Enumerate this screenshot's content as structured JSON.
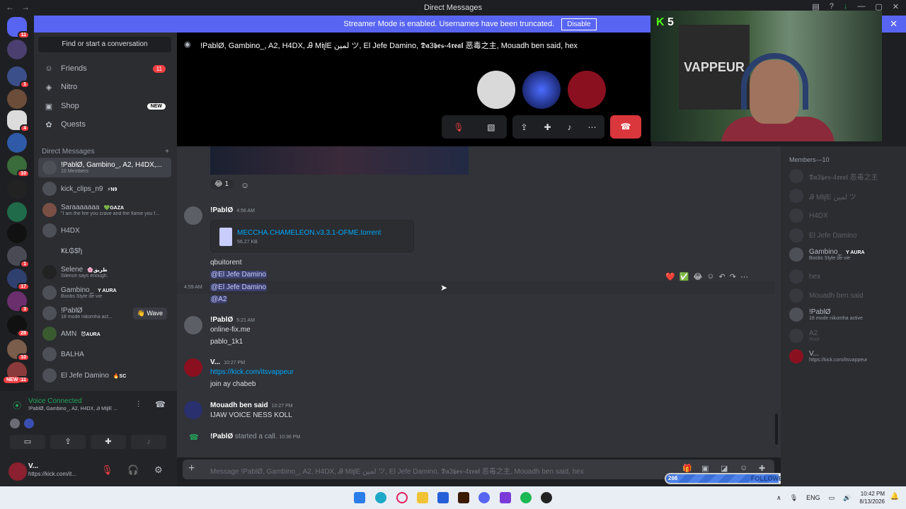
{
  "window": {
    "title": "Direct Messages"
  },
  "banner": {
    "text": "Streamer Mode is enabled. Usernames have been truncated.",
    "button": "Disable"
  },
  "servers": {
    "badges": [
      "11",
      "1",
      "4",
      "10",
      "1",
      "17",
      "3",
      "28",
      "10",
      "111"
    ],
    "new_label": "NEW"
  },
  "dm_sidebar": {
    "search": "Find or start a conversation",
    "nav": [
      {
        "label": "Friends",
        "badge": "11"
      },
      {
        "label": "Nitro"
      },
      {
        "label": "Shop",
        "badge": "NEW"
      },
      {
        "label": "Quests"
      }
    ],
    "header": "Direct Messages",
    "add": "+",
    "dms": [
      {
        "name": "!PablØ, Gambino_, A2, H4DX,...",
        "sub": "10 Members"
      },
      {
        "name": "kick_clips_n9",
        "tag": "⚡N9"
      },
      {
        "name": "Saraaaaaaa",
        "tag": "💚GAZA",
        "sub": "\"I am the fire you crave and the flame you f..."
      },
      {
        "name": "H4DX"
      },
      {
        "name": "ҜŁ₲$ђ"
      },
      {
        "name": "Selene",
        "tag": "🌸طريق",
        "sub": "Silence says enough."
      },
      {
        "name": "Gambino_",
        "tag": "Y AURA",
        "sub": "Boobs Style de vie"
      },
      {
        "name": "!PablØ",
        "sub": "18 mode nikomha act...",
        "wave": "👋 Wave"
      },
      {
        "name": "AMN",
        "tag": "😈AURA"
      },
      {
        "name": "BALHA"
      },
      {
        "name": "El Jefe Damino",
        "tag": "🔥SC"
      }
    ]
  },
  "voice": {
    "status": "Voice Connected",
    "channel": "!PablØ, Gambino_, A2, H4DX, Ꭿ MiʅlE ..."
  },
  "user": {
    "name": "V...",
    "status": "https://kick.com/it..."
  },
  "call": {
    "title": "!PablØ, Gambino_, A2, H4DX, Ꭿ MiʅlE لمين ツ, El Jefe Damino, 𝕯𝖆3𝖇𝖊𝖘-4𝖗𝖊𝖆𝖑 恶毒之主, Mouadh ben said, hex"
  },
  "webcam": {
    "kick_count": "5",
    "poster": "VAPPEUR"
  },
  "chat": {
    "reaction": {
      "emoji": "😂",
      "count": "1"
    },
    "messages": [
      {
        "author": "!PablØ",
        "time": "4:56 AM",
        "file_name": "MECCHA.CHAMELEON.v3.3.1-OFME.torrent",
        "file_size": "56.27 KB",
        "lines": [
          "qbuitorent",
          "@El Jefe Damino",
          "@El Jefe Damino",
          "@A2"
        ],
        "hover_time": "4:59 AM"
      },
      {
        "author": "!PablØ",
        "time": "5:21 AM",
        "lines": [
          "online-fix.me",
          "pablo_1k1"
        ]
      },
      {
        "author": "V...",
        "time": "10:27 PM",
        "lines": [
          "https://kick.com/itsvappeur",
          "join  ay  chabeb"
        ]
      },
      {
        "author": "Mouadh ben said",
        "time": "10:27 PM",
        "lines": [
          "IJAW VOICE NESS KOLL"
        ]
      },
      {
        "author": "!PablØ",
        "action": "started a call.",
        "time": "10:36 PM"
      }
    ],
    "input_placeholder": "Message !PablØ, Gambino_, A2, H4DX, Ꭿ MiʅlE لمين ツ, El Jefe Damino, 𝕯𝖆3𝖇𝖊𝖘-4𝖗𝖊𝖆𝖑 恶毒之主, Mouadh ben said, hex"
  },
  "followers": {
    "current": "266",
    "label": "FOLLOWERS",
    "goal": "500",
    "progress": 0.532
  },
  "members": {
    "header": "Members—10",
    "list": [
      {
        "name": "𝕯𝖆3𝖇𝖊𝖘-4𝖗𝖊𝖆𝖑 恶毒之主",
        "dim": true
      },
      {
        "name": "Ꭿ MiʅlE لمين ツ",
        "dim": true
      },
      {
        "name": "H4DX",
        "dim": true
      },
      {
        "name": "El Jefe Damino",
        "dim": true
      },
      {
        "name": "Gambino_",
        "tag": "Y AURA",
        "sub": "Boobs Style de vie"
      },
      {
        "name": "hex",
        "dim": true
      },
      {
        "name": "Mouadh ben said",
        "dim": true
      },
      {
        "name": "!PablØ",
        "sub": "18 mode nikomha active"
      },
      {
        "name": "A2",
        "sub": "Root",
        "dim": true
      },
      {
        "name": "V...",
        "sub": "https://kick.com/itsvappeur"
      }
    ]
  },
  "taskbar": {
    "lang": "ENG",
    "time": "10:42 PM",
    "date": "8/13/2026"
  },
  "colors": {
    "blurple": "#5865f2",
    "green": "#23a55a",
    "red": "#da373c",
    "bg": "#313338"
  }
}
